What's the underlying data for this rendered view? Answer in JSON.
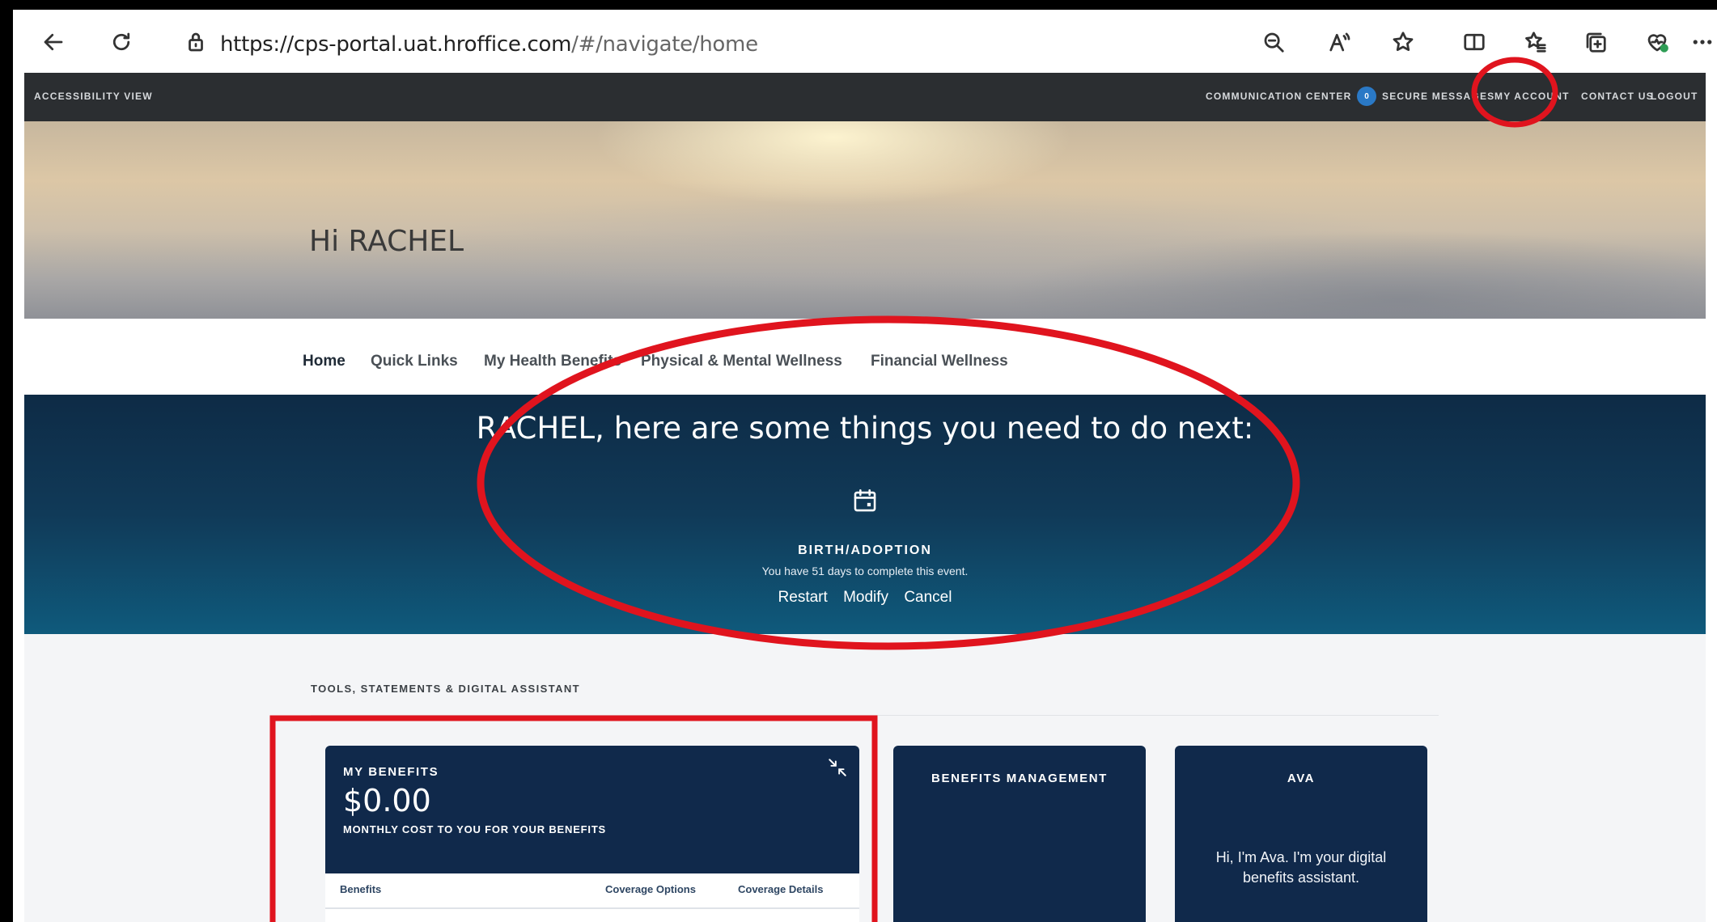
{
  "browser": {
    "url_main": "https://cps-portal.uat.hroffice.com",
    "url_rest": "/#/navigate/home",
    "icons": [
      "back-icon",
      "refresh-icon",
      "lock-icon",
      "zoom-out-icon",
      "read-aloud-icon",
      "favorite-star-icon",
      "split-screen-icon",
      "favorites-icon",
      "collections-icon",
      "browser-essentials-icon",
      "more-icon"
    ]
  },
  "utilbar": {
    "accessibility": "ACCESSIBILITY VIEW",
    "communication_center": "COMMUNICATION CENTER",
    "message_count": "0",
    "secure_messages": "SECURE MESSAGES",
    "my_account": "MY ACCOUNT",
    "contact_us": "CONTACT US",
    "logout": "LOGOUT"
  },
  "hero": {
    "greeting": "Hi RACHEL"
  },
  "nav": {
    "tabs": [
      {
        "label": "Home",
        "active": true
      },
      {
        "label": "Quick Links",
        "active": false
      },
      {
        "label": "My Health Benefits",
        "active": false
      },
      {
        "label": "Physical & Mental Wellness",
        "active": false
      },
      {
        "label": "Financial Wellness",
        "active": false
      }
    ]
  },
  "next_steps": {
    "title": "RACHEL, here are some things you need to do next:",
    "event_icon": "calendar-icon",
    "event_name": "BIRTH/ADOPTION",
    "event_sub": "You have 51 days to complete this event.",
    "actions": {
      "restart": "Restart",
      "modify": "Modify",
      "cancel": "Cancel"
    }
  },
  "tools": {
    "section_title": "TOOLS, STATEMENTS & DIGITAL ASSISTANT",
    "benefits_card": {
      "title": "MY BENEFITS",
      "amount": "$0.00",
      "subtitle": "MONTHLY COST TO YOU FOR YOUR BENEFITS",
      "columns": [
        "Benefits",
        "Coverage Options",
        "Coverage Details"
      ]
    },
    "management_card": {
      "title": "BENEFITS MANAGEMENT"
    },
    "ava_card": {
      "title": "AVA",
      "text": "Hi, I'm Ava. I'm your digital benefits assistant."
    }
  },
  "colors": {
    "utility_bar": "#2b2e31",
    "banner": "#103a58",
    "card": "#10294b",
    "annotation": "#e0141e",
    "badge": "#2a79c6"
  }
}
